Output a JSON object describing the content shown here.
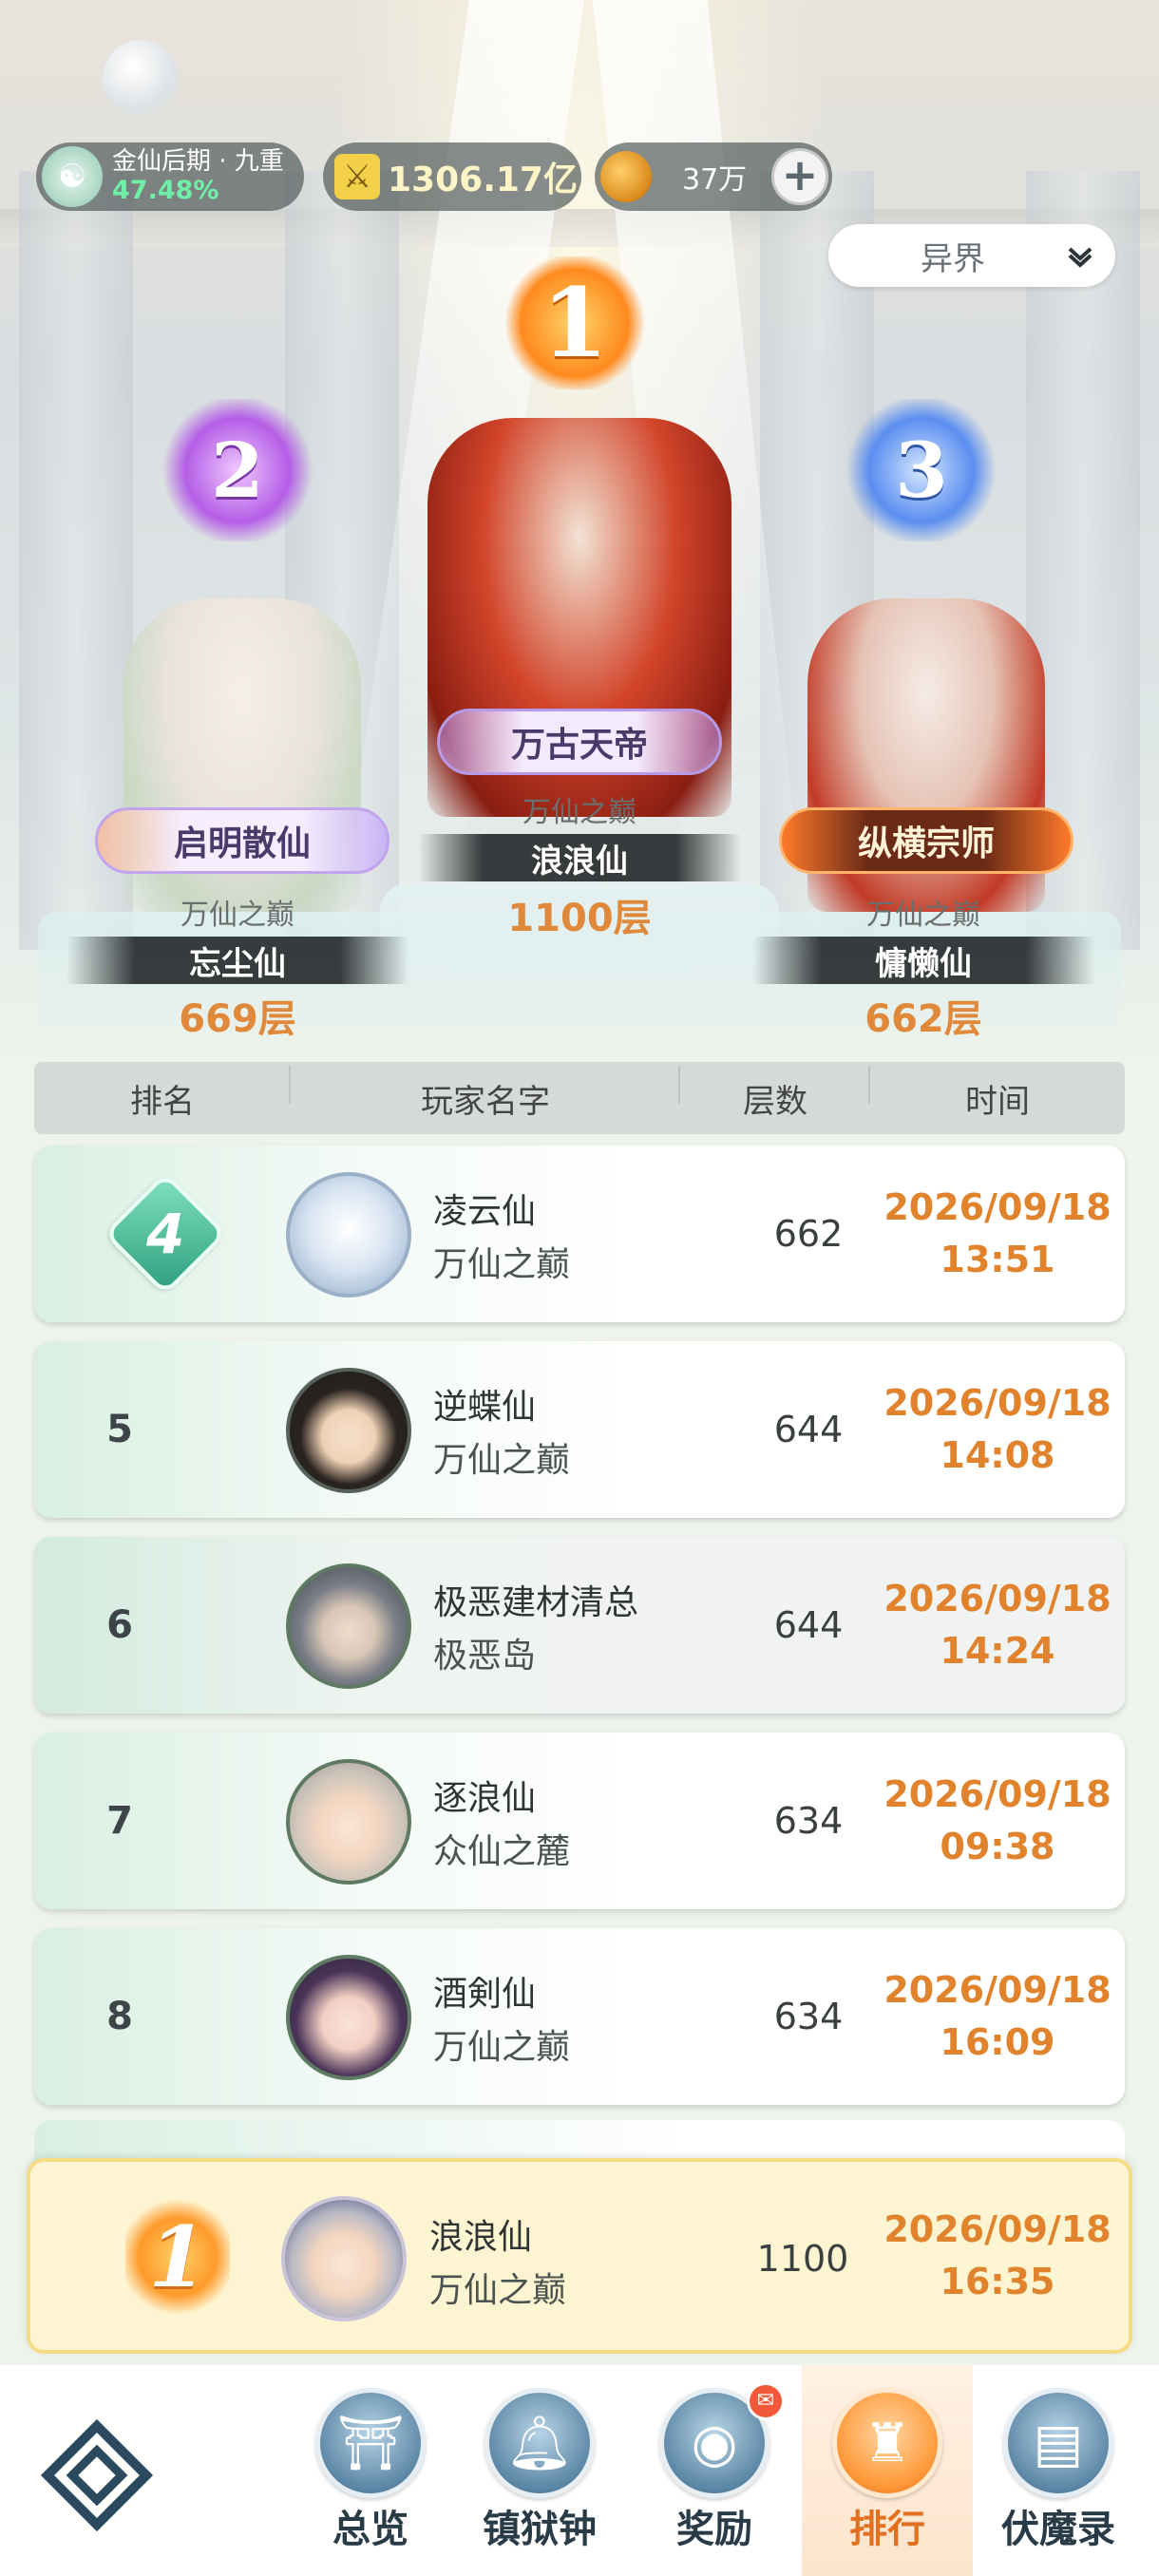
{
  "status": {
    "realm_name": "金仙后期 · 九重",
    "realm_progress": "47.48%",
    "power": "1306.17亿",
    "currency": "37万",
    "add_label": "+"
  },
  "realm_select": {
    "selected": "异界"
  },
  "podium": [
    {
      "rank": "1",
      "title": "万古天帝",
      "guild": "万仙之巅",
      "name": "浪浪仙",
      "floor": "1100层"
    },
    {
      "rank": "2",
      "title": "启明散仙",
      "guild": "万仙之巅",
      "name": "忘尘仙",
      "floor": "669层"
    },
    {
      "rank": "3",
      "title": "纵横宗师",
      "guild": "万仙之巅",
      "name": "慵懒仙",
      "floor": "662层"
    }
  ],
  "table": {
    "headers": {
      "rank": "排名",
      "name": "玩家名字",
      "floor": "层数",
      "time": "时间"
    },
    "rows": [
      {
        "rank": "4",
        "name": "凌云仙",
        "guild": "万仙之巅",
        "floor": "662",
        "date": "2026/09/18",
        "time": "13:51"
      },
      {
        "rank": "5",
        "name": "逆蝶仙",
        "guild": "万仙之巅",
        "floor": "644",
        "date": "2026/09/18",
        "time": "14:08"
      },
      {
        "rank": "6",
        "name": "极恶建材清总",
        "guild": "极恶岛",
        "floor": "644",
        "date": "2026/09/18",
        "time": "14:24"
      },
      {
        "rank": "7",
        "name": "逐浪仙",
        "guild": "众仙之麓",
        "floor": "634",
        "date": "2026/09/18",
        "time": "09:38"
      },
      {
        "rank": "8",
        "name": "酒剣仙",
        "guild": "万仙之巅",
        "floor": "634",
        "date": "2026/09/18",
        "time": "16:09"
      }
    ]
  },
  "my_rank": {
    "rank": "1",
    "name": "浪浪仙",
    "guild": "万仙之巅",
    "floor": "1100",
    "date": "2026/09/18",
    "time": "16:35"
  },
  "nav": {
    "items": [
      {
        "label": "总览",
        "icon": "pagoda-icon"
      },
      {
        "label": "镇狱钟",
        "icon": "bell-icon"
      },
      {
        "label": "奖励",
        "icon": "treasure-icon"
      },
      {
        "label": "排行",
        "icon": "ranking-icon"
      },
      {
        "label": "伏魔录",
        "icon": "scroll-icon"
      }
    ],
    "active": "排行"
  },
  "colors": {
    "accent": "#e0832c",
    "rank_badge": "#2fa07e",
    "active_tab": "#e3701e"
  }
}
